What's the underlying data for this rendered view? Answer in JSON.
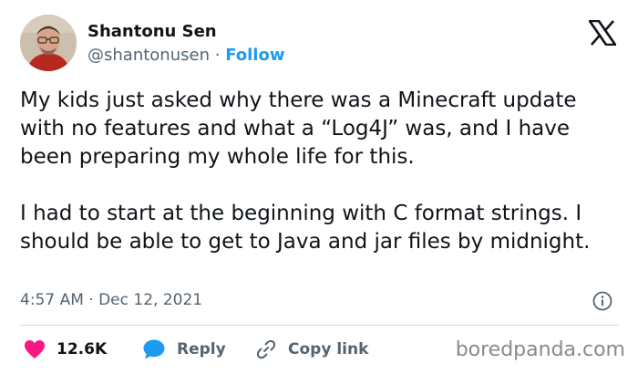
{
  "author": {
    "name": "Shantonu Sen",
    "handle": "@shantonusen",
    "separator": "·",
    "follow_label": "Follow"
  },
  "brand": {
    "logo_icon": "x-logo-icon",
    "color": "#0f1419"
  },
  "tweet": {
    "text": "My kids just asked why there was a Minecraft update with no features and what a “Log4J” was, and I have been preparing my whole life for this.\n\nI had to start at the beginning with C format strings. I should be able to get to Java and jar files by midnight.",
    "timestamp": "4:57 AM · Dec 12, 2021"
  },
  "actions": {
    "likes_count": "12.6K",
    "reply_label": "Reply",
    "copy_link_label": "Copy link"
  },
  "colors": {
    "like": "#f91880",
    "reply": "#1d9bf0",
    "follow": "#1d9bf0",
    "secondary_text": "#536471"
  },
  "watermark": "boredpanda.com"
}
